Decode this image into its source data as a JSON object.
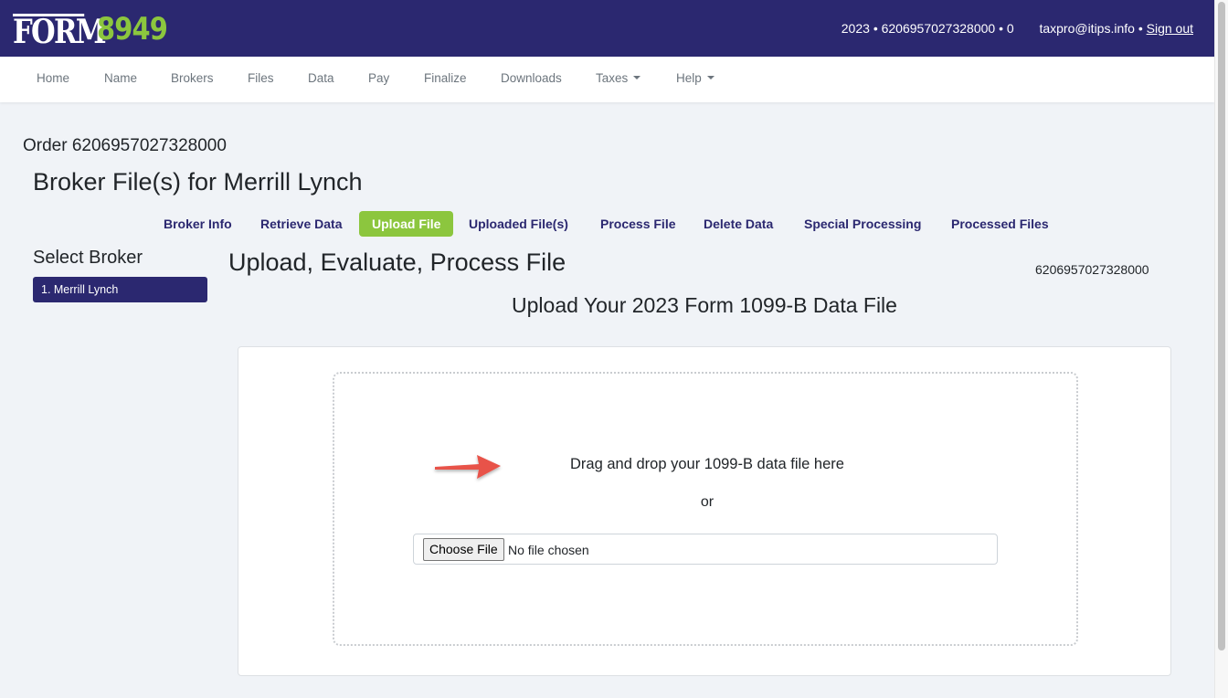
{
  "header": {
    "logo_word": "FORM",
    "logo_number": "8949",
    "year": "2023",
    "order_id": "6206957027328000",
    "count": "0",
    "separator": "•",
    "email": "taxpro@itips.info",
    "sign_out_label": "Sign out"
  },
  "nav": {
    "items": [
      {
        "label": "Home",
        "dropdown": false
      },
      {
        "label": "Name",
        "dropdown": false
      },
      {
        "label": "Brokers",
        "dropdown": false
      },
      {
        "label": "Files",
        "dropdown": false
      },
      {
        "label": "Data",
        "dropdown": false
      },
      {
        "label": "Pay",
        "dropdown": false
      },
      {
        "label": "Finalize",
        "dropdown": false
      },
      {
        "label": "Downloads",
        "dropdown": false
      },
      {
        "label": "Taxes",
        "dropdown": true
      },
      {
        "label": "Help",
        "dropdown": true
      }
    ]
  },
  "page": {
    "order_title": "Order 6206957027328000",
    "title": "Broker File(s) for Merrill Lynch"
  },
  "tabs": {
    "items": [
      {
        "label": "Broker Info",
        "active": false
      },
      {
        "label": "Retrieve Data",
        "active": false
      },
      {
        "label": "Upload File",
        "active": true
      },
      {
        "label": "Uploaded File(s)",
        "active": false
      },
      {
        "label": "Process File",
        "active": false
      },
      {
        "label": "Delete Data",
        "active": false
      },
      {
        "label": "Special Processing",
        "active": false
      },
      {
        "label": "Processed Files",
        "active": false
      }
    ]
  },
  "sidebar": {
    "title": "Select Broker",
    "brokers": [
      {
        "label": "1. Merrill Lynch",
        "selected": true
      }
    ]
  },
  "main": {
    "section_title": "Upload, Evaluate, Process File",
    "order_number": "6206957027328000",
    "upload_heading": "Upload Your 2023 Form 1099-B Data File",
    "drop_text": "Drag and drop your 1099-B data file here",
    "or_text": "or",
    "choose_file_label": "Choose File",
    "no_file_text": "No file chosen"
  },
  "colors": {
    "brand_navy": "#2b2870",
    "brand_green": "#8cc63e",
    "annotation_arrow": "#e8534a"
  }
}
